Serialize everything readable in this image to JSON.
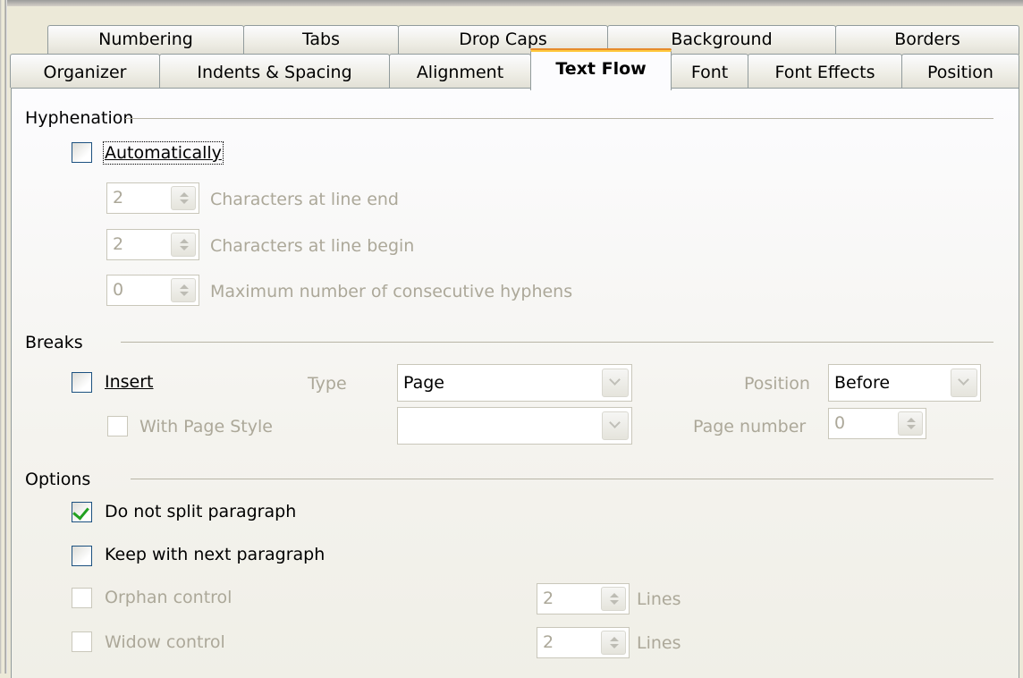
{
  "tabs_back": [
    "Numbering",
    "Tabs",
    "Drop Caps",
    "Background",
    "Borders"
  ],
  "tabs_front": [
    "Organizer",
    "Indents & Spacing",
    "Alignment",
    "Text Flow",
    "Font",
    "Font Effects",
    "Position"
  ],
  "active_tab": "Text Flow",
  "hyphenation": {
    "title": "Hyphenation",
    "automatically": {
      "label": "Automatically",
      "checked": false
    },
    "chars_line_end": {
      "label": "Characters at line end",
      "value": "2"
    },
    "chars_line_begin": {
      "label": "Characters at line begin",
      "value": "2"
    },
    "max_hyphens": {
      "label": "Maximum number of consecutive hyphens",
      "value": "0"
    }
  },
  "breaks": {
    "title": "Breaks",
    "insert": {
      "label": "Insert",
      "checked": false
    },
    "type_label": "Type",
    "type_value": "Page",
    "position_label": "Position",
    "position_value": "Before",
    "with_page_style": {
      "label": "With Page Style",
      "checked": false
    },
    "page_style_value": "",
    "page_number_label": "Page number",
    "page_number_value": "0"
  },
  "options": {
    "title": "Options",
    "do_not_split": {
      "label": "Do not split paragraph",
      "checked": true
    },
    "keep_with_next": {
      "label": "Keep with next paragraph",
      "checked": false
    },
    "orphan": {
      "label": "Orphan control",
      "value": "2",
      "unit": "Lines"
    },
    "widow": {
      "label": "Widow control",
      "value": "2",
      "unit": "Lines"
    }
  },
  "colors": {
    "window_bg": "#ece9d8",
    "active_tab_highlight": "#ffc83c",
    "checkbox_border": "#1c5180",
    "check_mark": "#21a121",
    "disabled_text": "#aca899"
  }
}
